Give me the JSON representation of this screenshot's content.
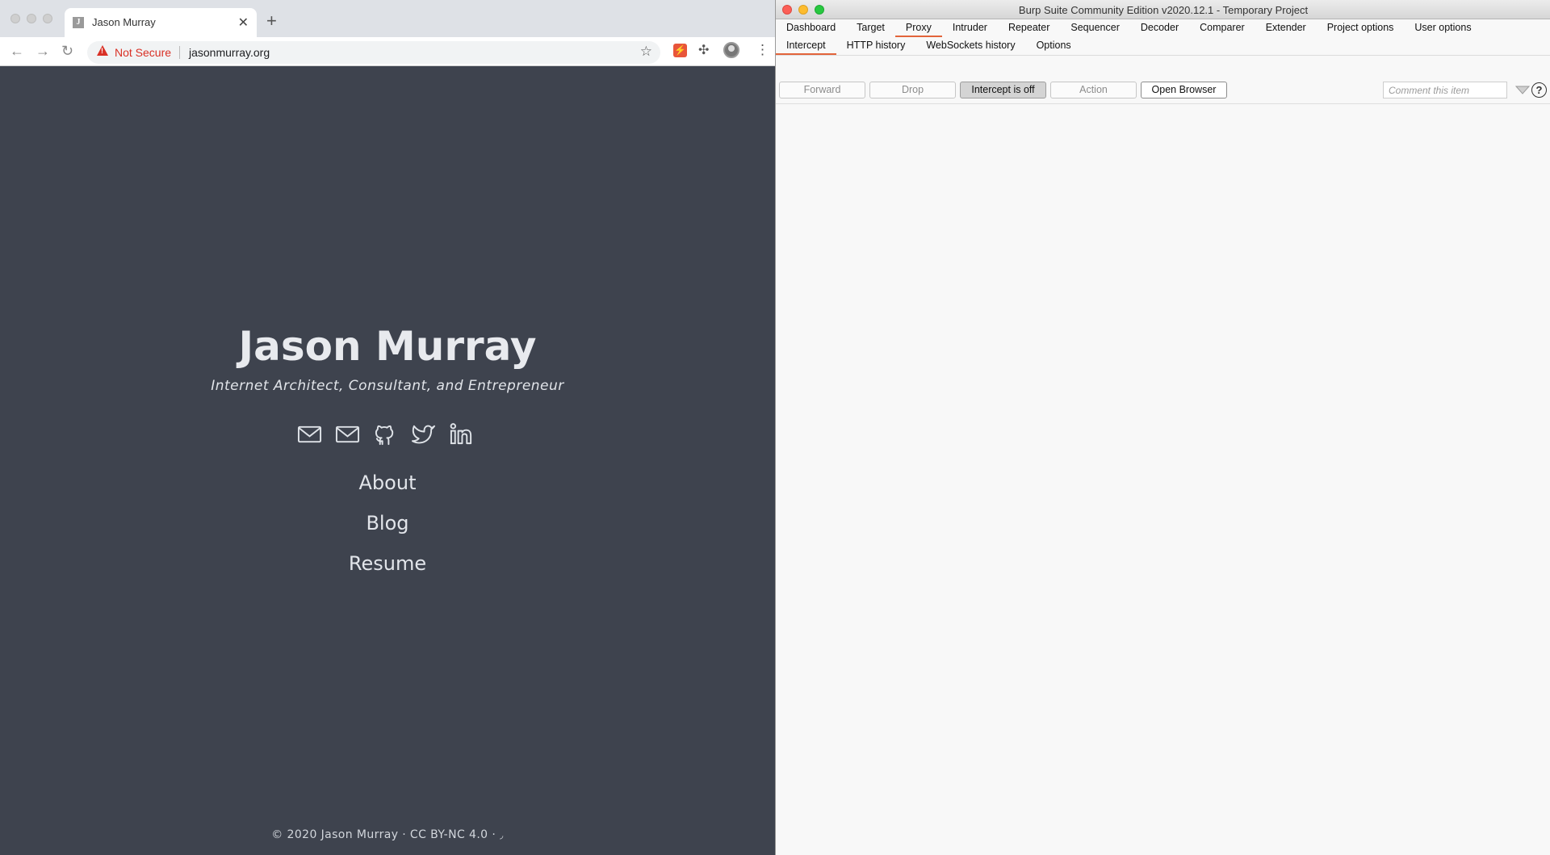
{
  "browser": {
    "tab_title": "Jason Murray",
    "favicon_letter": "J",
    "security_label": "Not Secure",
    "url": "jasonmurray.org"
  },
  "site": {
    "name": "Jason Murray",
    "subtitle": "Internet Architect, Consultant, and Entrepreneur",
    "social_icons": [
      "mail-icon",
      "mail-icon",
      "github-icon",
      "twitter-icon",
      "linkedin-icon"
    ],
    "nav": [
      "About",
      "Blog",
      "Resume"
    ],
    "footer": "© 2020 Jason Murray · CC BY-NC 4.0 ·"
  },
  "burp": {
    "window_title": "Burp Suite Community Edition v2020.12.1 - Temporary Project",
    "tabs": [
      "Dashboard",
      "Target",
      "Proxy",
      "Intruder",
      "Repeater",
      "Sequencer",
      "Decoder",
      "Comparer",
      "Extender",
      "Project options",
      "User options"
    ],
    "active_tab": "Proxy",
    "subtabs": [
      "Intercept",
      "HTTP history",
      "WebSockets history",
      "Options"
    ],
    "active_subtab": "Intercept",
    "buttons": {
      "forward": "Forward",
      "drop": "Drop",
      "intercept": "Intercept is off",
      "action": "Action",
      "open_browser": "Open Browser"
    },
    "comment_placeholder": "Comment this item"
  },
  "colors": {
    "site_bg": "#3e434e",
    "accent_tab": "#e2643b",
    "warning_red": "#d93025"
  }
}
